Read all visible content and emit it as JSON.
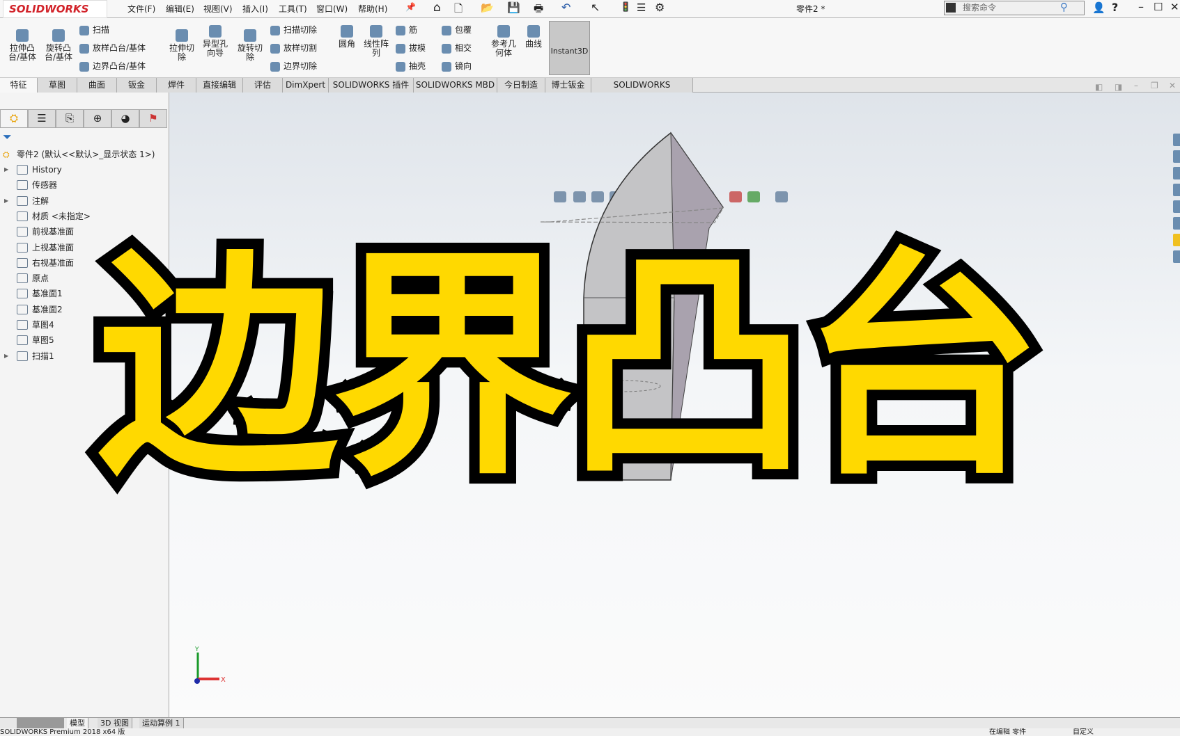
{
  "app": {
    "logo": "SOLIDWORKS",
    "doc_title": "零件2 *",
    "search_placeholder": "搜索命令"
  },
  "menu": [
    "文件(F)",
    "编辑(E)",
    "视图(V)",
    "插入(I)",
    "工具(T)",
    "窗口(W)",
    "帮助(H)"
  ],
  "ribbon": {
    "extrude_boss": "拉伸凸台/基体",
    "revolve_boss": "旋转凸台/基体",
    "sweep": "扫描",
    "loft": "放样凸台/基体",
    "boundary_boss": "边界凸台/基体",
    "extrude_cut": "拉伸切除",
    "hole_wizard": "异型孔向导",
    "revolve_cut": "旋转切除",
    "swept_cut": "扫描切除",
    "lofted_cut": "放样切割",
    "boundary_cut": "边界切除",
    "fillet": "圆角",
    "linear_pattern": "线性阵列",
    "rib": "筋",
    "draft": "拔模",
    "shell": "抽壳",
    "wrap": "包覆",
    "intersect": "相交",
    "mirror": "镜向",
    "ref_geometry": "参考几何体",
    "curves": "曲线",
    "instant3d": "Instant3D"
  },
  "tabs": [
    "特征",
    "草图",
    "曲面",
    "钣金",
    "焊件",
    "直接编辑",
    "评估",
    "DimXpert",
    "SOLIDWORKS 插件",
    "SOLIDWORKS MBD",
    "今日制造",
    "博士钣金",
    "SOLIDWORKS Inspection"
  ],
  "tree": {
    "root": "零件2  (默认<<默认>_显示状态 1>)",
    "items": [
      {
        "label": "History",
        "expandable": true
      },
      {
        "label": "传感器",
        "expandable": false
      },
      {
        "label": "注解",
        "expandable": true
      },
      {
        "label": "材质 <未指定>",
        "expandable": false
      },
      {
        "label": "前视基准面",
        "expandable": false
      },
      {
        "label": "上视基准面",
        "expandable": false
      },
      {
        "label": "右视基准面",
        "expandable": false
      },
      {
        "label": "原点",
        "expandable": false
      },
      {
        "label": "基准面1",
        "expandable": false
      },
      {
        "label": "基准面2",
        "expandable": false
      },
      {
        "label": "草图4",
        "expandable": false
      },
      {
        "label": "草图5",
        "expandable": false
      },
      {
        "label": "扫描1",
        "expandable": true
      }
    ]
  },
  "overlay_title": "边界凸台",
  "triad": {
    "x": "X",
    "y": "Y"
  },
  "bottom_tabs": [
    "模型",
    "3D 视图",
    "运动算例 1"
  ],
  "status": {
    "left": "SOLIDWORKS Premium 2018 x64 版",
    "mid": "在编辑 零件",
    "right": "自定义"
  },
  "colors": {
    "overlay_fill": "#ffd900",
    "overlay_stroke": "#000000",
    "brand": "#d2232a"
  }
}
